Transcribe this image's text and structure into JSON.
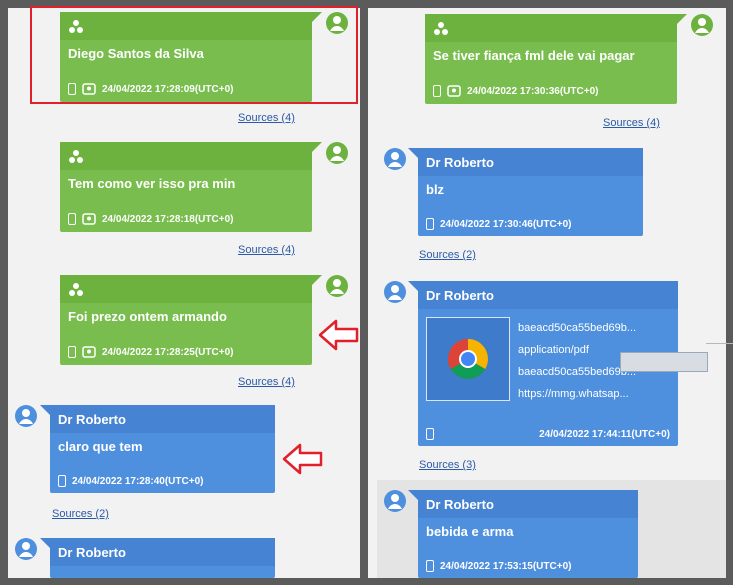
{
  "left_column": {
    "messages": [
      {
        "avatar": "user-icon",
        "text": "Diego Santos da Silva",
        "timestamp": "24/04/2022 17:28:09(UTC+0)",
        "sources": "Sources (4)"
      },
      {
        "avatar": "user-icon",
        "text": "Tem como ver isso pra min",
        "timestamp": "24/04/2022 17:28:18(UTC+0)",
        "sources": "Sources (4)"
      },
      {
        "avatar": "user-icon",
        "text": "Foi prezo ontem armando",
        "timestamp": "24/04/2022 17:28:25(UTC+0)",
        "sources": "Sources (4)"
      },
      {
        "sender": "Dr Roberto",
        "text": "claro que tem",
        "timestamp": "24/04/2022 17:28:40(UTC+0)",
        "sources": "Sources (2)"
      },
      {
        "sender": "Dr Roberto"
      }
    ]
  },
  "right_column": {
    "messages": [
      {
        "text": "Se tiver fiança fml dele vai pagar",
        "timestamp": "24/04/2022 17:30:36(UTC+0)",
        "sources": "Sources (4)"
      },
      {
        "sender": "Dr Roberto",
        "text": "blz",
        "timestamp": "24/04/2022 17:30:46(UTC+0)",
        "sources": "Sources (2)"
      },
      {
        "sender": "Dr Roberto",
        "attachment": {
          "line1": "baeacd50ca55bed69b...",
          "line2": "application/pdf",
          "line3": "baeacd50ca55bed69b...",
          "line4": "https://mmg.whatsap..."
        },
        "timestamp": "24/04/2022 17:44:11(UTC+0)",
        "sources": "Sources (3)"
      },
      {
        "sender": "Dr Roberto",
        "text": "bebida e arma",
        "timestamp": "24/04/2022 17:53:15(UTC+0)"
      }
    ]
  },
  "colors": {
    "green": "#78bd4d",
    "blue": "#4e8fde",
    "highlight": "#e0202a"
  }
}
